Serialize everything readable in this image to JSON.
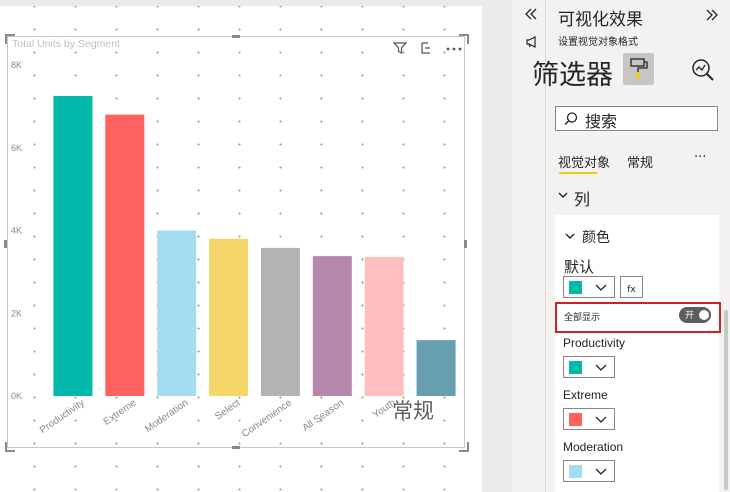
{
  "chart": {
    "title": "Total Units by Segment",
    "overlay_label": "常规"
  },
  "chart_data": {
    "type": "bar",
    "title": "Total Units by Segment",
    "categories": [
      "Productivity",
      "Extreme",
      "Moderation",
      "Select",
      "Convenience",
      "All Season",
      "Youth",
      ""
    ],
    "values": [
      7250,
      6800,
      4000,
      3800,
      3580,
      3380,
      3360,
      1350
    ],
    "colors": [
      "#01b8aa",
      "#fd625e",
      "#a6dcef",
      "#f5d66b",
      "#b3b3b3",
      "#b687ac",
      "#ffbfbf",
      "#689fb0"
    ],
    "ylim": [
      0,
      8000
    ],
    "yticks": [
      "0K",
      "2K",
      "4K",
      "6K",
      "8K"
    ],
    "ytick_values": [
      0,
      2000,
      4000,
      6000,
      8000
    ],
    "grid": false,
    "legend": "none"
  },
  "pane": {
    "title": "可视化效果",
    "subtitle": "设置视觉对象格式",
    "filters_label": "筛选器",
    "search_placeholder": "搜索",
    "tab_visual": "视觉对象",
    "tab_general": "常规",
    "more": "···",
    "section_columns": "列",
    "group_colors": "颜色",
    "default_label": "默认",
    "fx": "fx",
    "show_all_label": "全部显示",
    "toggle_on": "开",
    "series": [
      {
        "name": "Productivity",
        "color": "#01b8aa"
      },
      {
        "name": "Extreme",
        "color": "#fd625e"
      },
      {
        "name": "Moderation",
        "color": "#a6dcef"
      }
    ],
    "default_color": "#01b8aa"
  }
}
